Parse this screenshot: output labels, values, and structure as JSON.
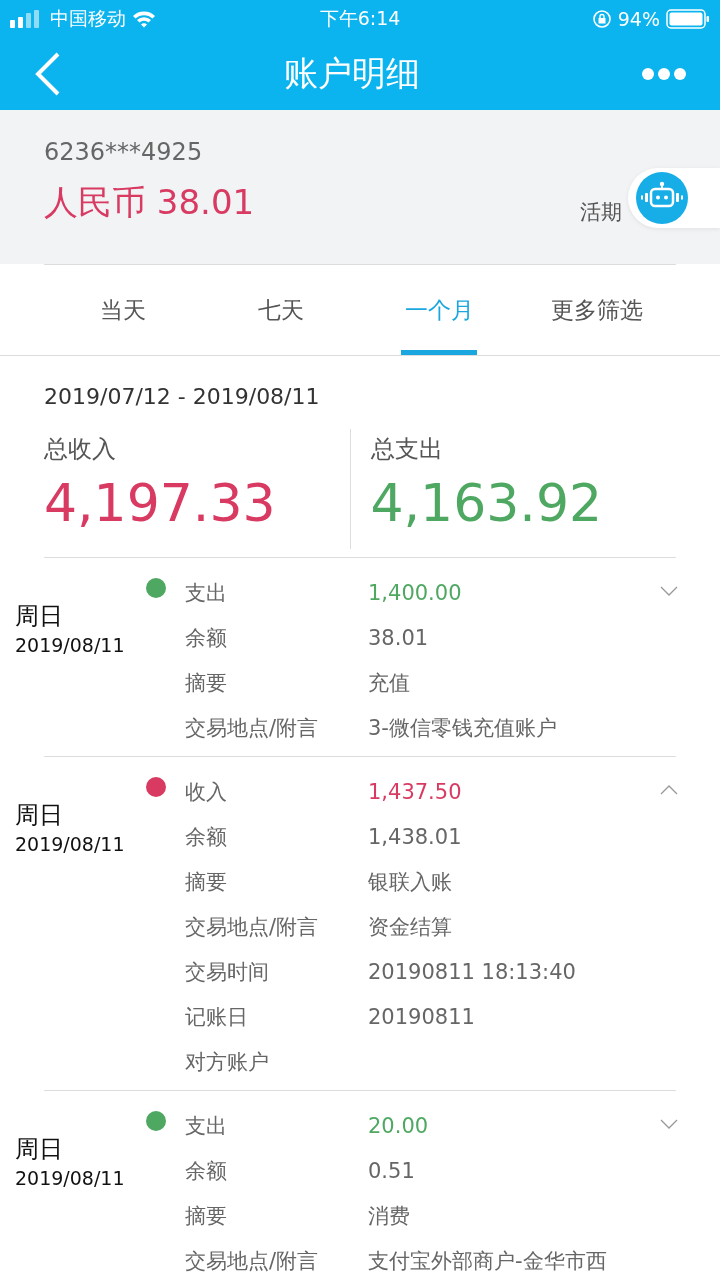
{
  "status_bar": {
    "carrier": "中国移动",
    "time": "下午6:14",
    "battery": "94%"
  },
  "nav": {
    "title": "账户明细"
  },
  "account": {
    "number": "6236***4925",
    "balance": "人民币 38.01",
    "type": "活期"
  },
  "tabs": [
    {
      "label": "当天",
      "selected": false
    },
    {
      "label": "七天",
      "selected": false
    },
    {
      "label": "一个月",
      "selected": true
    },
    {
      "label": "更多筛选",
      "selected": false
    }
  ],
  "period": "2019/07/12 - 2019/08/11",
  "totals": [
    {
      "kind": "income",
      "label": "总收入",
      "amount": "4,197.33"
    },
    {
      "kind": "expense",
      "label": "总支出",
      "amount": "4,163.92"
    }
  ],
  "entries": [
    {
      "kind": "expense",
      "weekday": "周日",
      "date": "2019/08/11",
      "expanded": false,
      "fields": [
        {
          "label": "支出",
          "value": "1,400.00"
        },
        {
          "label": "余额",
          "value": "38.01"
        },
        {
          "label": "摘要",
          "value": "充值"
        },
        {
          "label": "交易地点/附言",
          "value": "3-微信零钱充值账户"
        }
      ]
    },
    {
      "kind": "income",
      "weekday": "周日",
      "date": "2019/08/11",
      "expanded": true,
      "fields": [
        {
          "label": "收入",
          "value": "1,437.50"
        },
        {
          "label": "余额",
          "value": "1,438.01"
        },
        {
          "label": "摘要",
          "value": "银联入账"
        },
        {
          "label": "交易地点/附言",
          "value": "资金结算"
        },
        {
          "label": "交易时间",
          "value": "20190811 18:13:40"
        },
        {
          "label": "记账日",
          "value": "20190811"
        },
        {
          "label": "对方账户"
        }
      ]
    },
    {
      "kind": "expense",
      "weekday": "周日",
      "date": "2019/08/11",
      "expanded": false,
      "fields": [
        {
          "label": "支出",
          "value": "20.00"
        },
        {
          "label": "余额",
          "value": "0.51"
        },
        {
          "label": "摘要",
          "value": "消费"
        },
        {
          "label": "交易地点/附言",
          "value": "支付宝外部商户-金华市西"
        }
      ]
    }
  ]
}
